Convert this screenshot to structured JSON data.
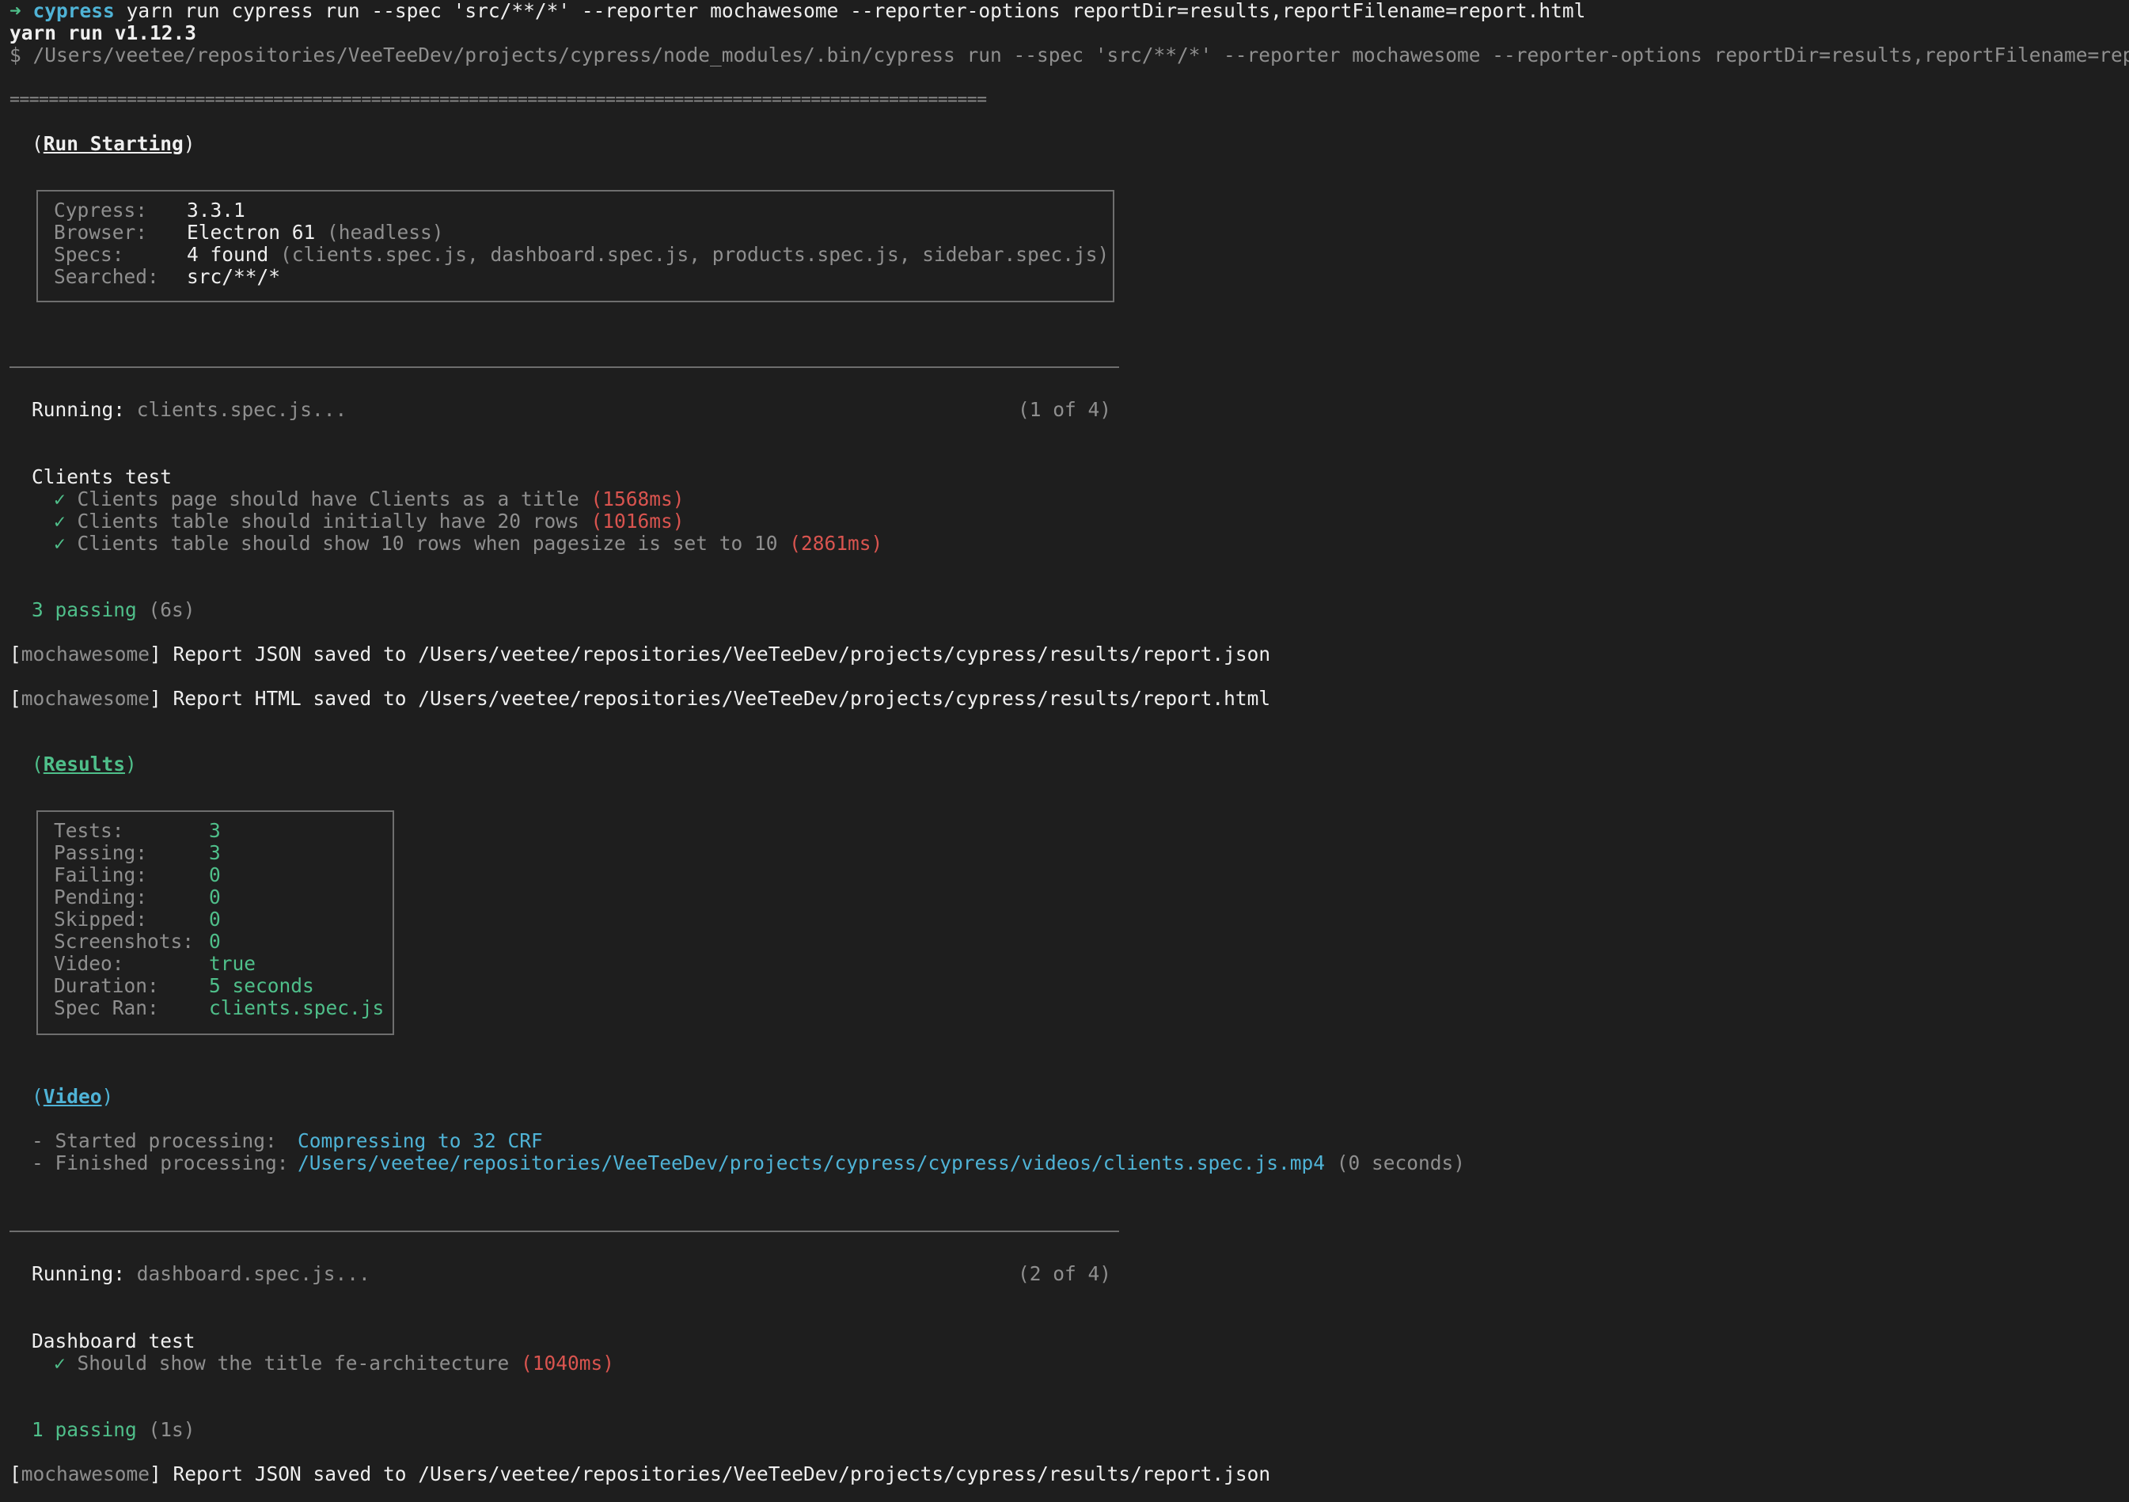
{
  "prompt": {
    "arrow": "➜",
    "dir": "cypress",
    "command": "yarn run cypress run --spec 'src/**/*' --reporter mochawesome --reporter-options reportDir=results,reportFilename=report.html"
  },
  "yarn_version": "yarn run v1.12.3",
  "exec_line": "$ /Users/veetee/repositories/VeeTeeDev/projects/cypress/node_modules/.bin/cypress run --spec 'src/**/*' --reporter mochawesome --reporter-options reportDir=results,reportFilename=report.html",
  "separator": "====================================================================================================",
  "run_starting": {
    "paren_open": "(",
    "title": "Run Starting",
    "paren_close": ")",
    "rows": [
      {
        "label": "Cypress:",
        "value": "3.3.1",
        "extra": ""
      },
      {
        "label": "Browser:",
        "value": "Electron 61",
        "extra": " (headless)"
      },
      {
        "label": "Specs:",
        "value": "4 found",
        "extra": " (clients.spec.js, dashboard.spec.js, products.spec.js, sidebar.spec.js)"
      },
      {
        "label": "Searched:",
        "value": "src/**/*",
        "extra": ""
      }
    ]
  },
  "spec1": {
    "running_label": "Running:",
    "file": " clients.spec.js...",
    "counter": "(1 of 4)",
    "suite": "Clients test",
    "tests": [
      {
        "check": "✓",
        "name": " Clients page should have Clients as a title ",
        "time": "(1568ms)"
      },
      {
        "check": "✓",
        "name": " Clients table should initially have 20 rows ",
        "time": "(1016ms)"
      },
      {
        "check": "✓",
        "name": " Clients table should show 10 rows when pagesize is set to 10 ",
        "time": "(2861ms)"
      }
    ],
    "passing": "3 passing",
    "passing_time": " (6s)",
    "reports": [
      {
        "tag": "mochawesome",
        "text": " Report JSON saved to /Users/veetee/repositories/VeeTeeDev/projects/cypress/results/report.json"
      },
      {
        "tag": "mochawesome",
        "text": " Report HTML saved to /Users/veetee/repositories/VeeTeeDev/projects/cypress/results/report.html"
      }
    ],
    "results": {
      "title": "Results",
      "rows": [
        {
          "label": "Tests:",
          "value": "3"
        },
        {
          "label": "Passing:",
          "value": "3"
        },
        {
          "label": "Failing:",
          "value": "0"
        },
        {
          "label": "Pending:",
          "value": "0"
        },
        {
          "label": "Skipped:",
          "value": "0"
        },
        {
          "label": "Screenshots:",
          "value": "0"
        },
        {
          "label": "Video:",
          "value": "true"
        },
        {
          "label": "Duration:",
          "value": "5 seconds"
        },
        {
          "label": "Spec Ran:",
          "value": "clients.spec.js"
        }
      ]
    },
    "video": {
      "title": "Video",
      "started_label": "- Started processing:",
      "started_value": "Compressing to 32 CRF",
      "finished_label": "- Finished processing:",
      "finished_value": "/Users/veetee/repositories/VeeTeeDev/projects/cypress/cypress/videos/clients.spec.js.mp4",
      "finished_extra": " (0 seconds)"
    }
  },
  "spec2": {
    "running_label": "Running:",
    "file": " dashboard.spec.js...",
    "counter": "(2 of 4)",
    "suite": "Dashboard test",
    "tests": [
      {
        "check": "✓",
        "name": " Should show the title fe-architecture ",
        "time": "(1040ms)"
      }
    ],
    "passing": "1 passing",
    "passing_time": " (1s)",
    "reports": [
      {
        "tag": "mochawesome",
        "text": " Report JSON saved to /Users/veetee/repositories/VeeTeeDev/projects/cypress/results/report.json"
      }
    ]
  },
  "brackets": {
    "open": "[",
    "close": "]"
  },
  "colors": {
    "background": "#1e1e1e",
    "green": "#4fbf8a",
    "red": "#d9544f",
    "cyan": "#4fb3d6",
    "muted": "#8f8f8f"
  }
}
